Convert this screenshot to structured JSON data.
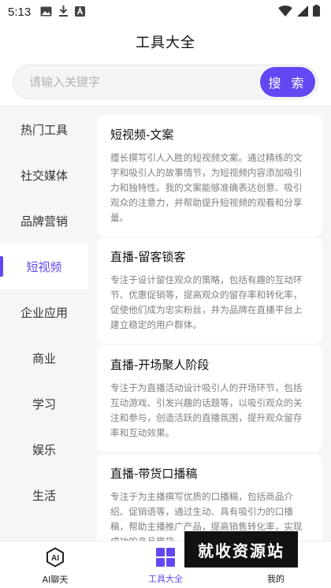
{
  "status_bar": {
    "time": "5:13"
  },
  "header": {
    "title": "工具大全"
  },
  "search": {
    "placeholder": "请输入关键字",
    "button_label": "搜 索"
  },
  "sidebar": {
    "items": [
      {
        "label": "热门工具"
      },
      {
        "label": "社交媒体"
      },
      {
        "label": "品牌营销"
      },
      {
        "label": "短视频",
        "active": true
      },
      {
        "label": "企业应用"
      },
      {
        "label": "商业"
      },
      {
        "label": "学习"
      },
      {
        "label": "娱乐"
      },
      {
        "label": "生活"
      }
    ]
  },
  "cards": [
    {
      "title": "短视频-文案",
      "description": "擅长撰写引人入胜的短视频文案。通过精练的文字和吸引人的故事情节，为短视频内容添加吸引力和独特性。我的文案能够准确表达创意、吸引观众的注意力，并帮助提升短视频的观看和分享量。"
    },
    {
      "title": "直播-留客锁客",
      "description": "专注于设计留住观众的策略，包括有趣的互动环节、优惠促销等，提高观众的留存率和转化率，促使他们成为忠实粉丝，并为品牌在直播平台上建立稳定的用户群体。"
    },
    {
      "title": "直播-开场聚人阶段",
      "description": "专注于为直播活动设计吸引人的开场环节，包括互动游戏、引发兴趣的话题等，以吸引观众的关注和参与，创造活跃的直播氛围，提升观众留存率和互动效果。"
    },
    {
      "title": "直播-带货口播稿",
      "description": "专注于为主播撰写优质的口播稿，包括商品介绍、促销语等，通过生动、具有吸引力的口播稿，帮助主播推广产品，提高销售转化率，实现成功的产品带货。"
    }
  ],
  "tabbar": {
    "tabs": [
      {
        "label": "AI聊天",
        "icon": "ai-badge-icon"
      },
      {
        "label": "工具大全",
        "icon": "grid-icon",
        "active": true
      },
      {
        "label": "我的",
        "icon": "profile-icon"
      }
    ]
  },
  "watermark": {
    "text": "就收资源站"
  },
  "colors": {
    "accent": "#6347f3",
    "sidebar_bg": "#f6f6f8",
    "desc_text": "#808086"
  }
}
